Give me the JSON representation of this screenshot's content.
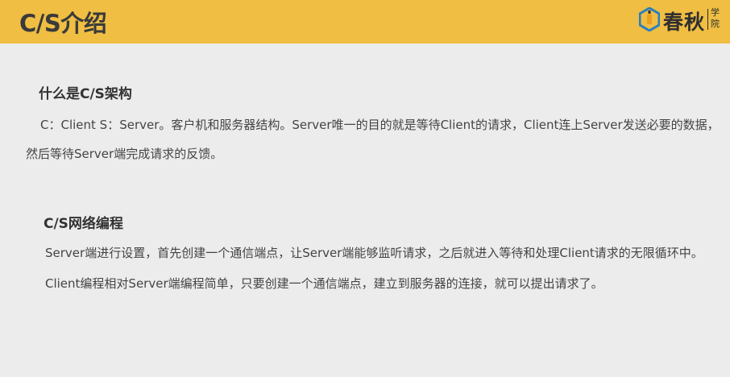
{
  "header": {
    "title": "C/S介绍",
    "logo": {
      "name": "春秋",
      "sub_1": "学",
      "sub_2": "院",
      "icon": "shield-diamond-icon",
      "accent": "#2a7fbf"
    },
    "background": "#efbe43"
  },
  "sections": [
    {
      "title": "什么是C/S架构",
      "lines": [
        "C：Client  S：Server。客户机和服务器结构。Server唯一的目的就是等待Client的请求，Client连上Server发送必要的数据，",
        "然后等待Server端完成请求的反馈。"
      ]
    },
    {
      "title": "C/S网络编程",
      "lines": [
        "Server端进行设置，首先创建一个通信端点，让Server端能够监听请求，之后就进入等待和处理Client请求的无限循环中。",
        "Client编程相对Server端编程简单，只要创建一个通信端点，建立到服务器的连接，就可以提出请求了。"
      ]
    }
  ]
}
